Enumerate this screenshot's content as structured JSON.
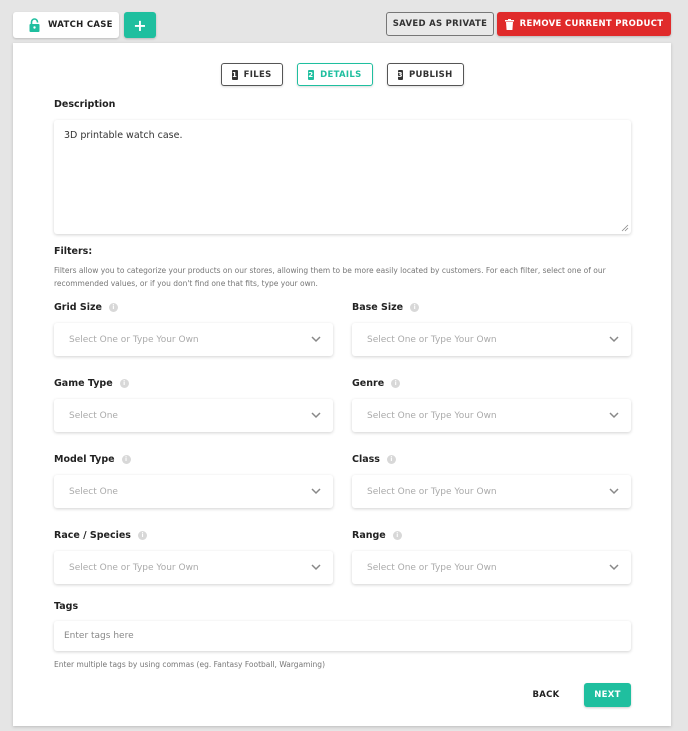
{
  "topbar": {
    "product_tab_label": "WATCH CASE",
    "add_button_label": "+",
    "saved_status_label": "SAVED AS PRIVATE",
    "remove_button_label": "REMOVE CURRENT PRODUCT"
  },
  "steps": [
    {
      "number": "1",
      "label": "FILES",
      "active": false
    },
    {
      "number": "2",
      "label": "DETAILS",
      "active": true
    },
    {
      "number": "3",
      "label": "PUBLISH",
      "active": false
    }
  ],
  "description": {
    "label": "Description",
    "value": "3D printable watch case."
  },
  "filters": {
    "title": "Filters:",
    "help_text": "Filters allow you to categorize your products on our stores, allowing them to be more easily located by customers. For each filter, select one of our recommended values, or if you don't find one that fits, type your own.",
    "fields": [
      {
        "label": "Grid Size",
        "placeholder": "Select One or Type Your Own"
      },
      {
        "label": "Base Size",
        "placeholder": "Select One or Type Your Own"
      },
      {
        "label": "Game Type",
        "placeholder": "Select One"
      },
      {
        "label": "Genre",
        "placeholder": "Select One or Type Your Own"
      },
      {
        "label": "Model Type",
        "placeholder": "Select One"
      },
      {
        "label": "Class",
        "placeholder": "Select One or Type Your Own"
      },
      {
        "label": "Race / Species",
        "placeholder": "Select One or Type Your Own"
      },
      {
        "label": "Range",
        "placeholder": "Select One or Type Your Own"
      }
    ]
  },
  "tags": {
    "label": "Tags",
    "placeholder": "Enter tags here",
    "help_text": "Enter multiple tags by using commas (eg. Fantasy Football, Wargaming)"
  },
  "footer": {
    "back_label": "BACK",
    "next_label": "NEXT"
  },
  "colors": {
    "accent": "#1fbf9f",
    "danger": "#e02b2b",
    "background": "#e5e5e5"
  },
  "icons": {
    "product_tab": "lock-icon",
    "remove": "trash-icon",
    "info": "info-icon",
    "dropdown": "chevron-down-icon"
  }
}
